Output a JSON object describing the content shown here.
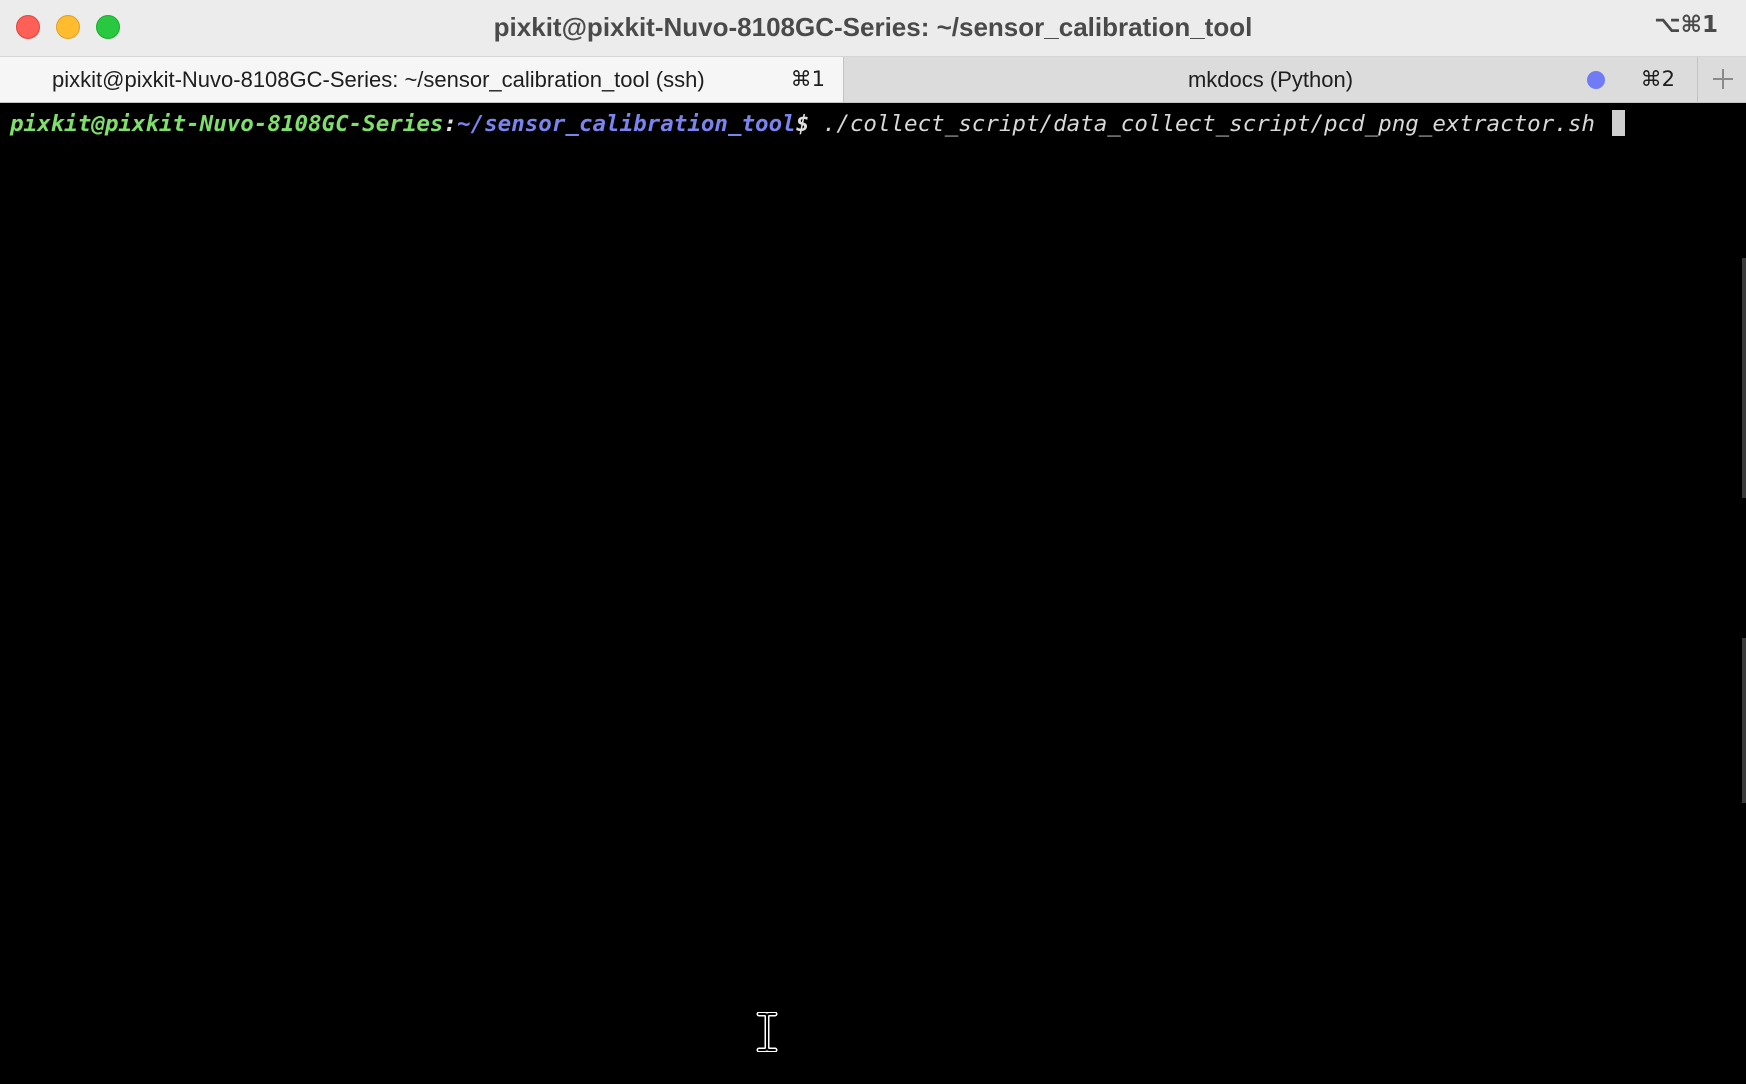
{
  "window": {
    "title": "pixkit@pixkit-Nuvo-8108GC-Series: ~/sensor_calibration_tool",
    "shortcut": "⌥⌘1"
  },
  "tabs": [
    {
      "label": "pixkit@pixkit-Nuvo-8108GC-Series: ~/sensor_calibration_tool (ssh)",
      "shortcut": "⌘1",
      "active": true
    },
    {
      "label": "mkdocs (Python)",
      "shortcut": "⌘2",
      "active": false,
      "activity_dot_color": "#6f7cf5"
    }
  ],
  "terminal": {
    "prompt_user": "pixkit@pixkit-Nuvo-8108GC-Series",
    "prompt_colon": ":",
    "prompt_path": "~/sensor_calibration_tool",
    "prompt_dollar": "$",
    "command": "./collect_script/data_collect_script/pcd_png_extractor.sh"
  },
  "colors": {
    "prompt_user": "#7ee06a",
    "prompt_path": "#7b83ef",
    "close": "#fe5f57",
    "minimize": "#febc2e",
    "zoom": "#28c840"
  },
  "icons": {
    "close": "close-icon",
    "minimize": "minimize-icon",
    "zoom": "zoom-icon",
    "new_tab": "plus-icon",
    "text_cursor": "i-beam-cursor-icon"
  }
}
